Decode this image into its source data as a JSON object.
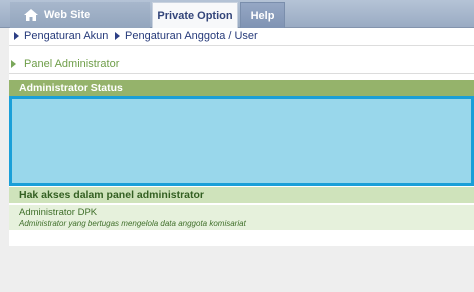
{
  "top_tabs": [
    {
      "label": "Web Site"
    },
    {
      "label": "Private Option"
    },
    {
      "label": "Help"
    }
  ],
  "submenu": [
    {
      "label": "Pengaturan Akun"
    },
    {
      "label": "Pengaturan Anggota / User"
    }
  ],
  "panel_title": "Panel Administrator",
  "status": {
    "header": "Administrator Status"
  },
  "hak_akses": {
    "header": "Hak akses dalam panel administrator",
    "rows": [
      {
        "name": "Administrator DPK",
        "description": "Administrator yang bertugas mengelola data anggota komisariat"
      }
    ]
  },
  "colors": {
    "topbar": "#9aabc3",
    "status_header": "#95b36b",
    "status_box": "#99d7eb",
    "status_border": "#1a9fd8"
  }
}
